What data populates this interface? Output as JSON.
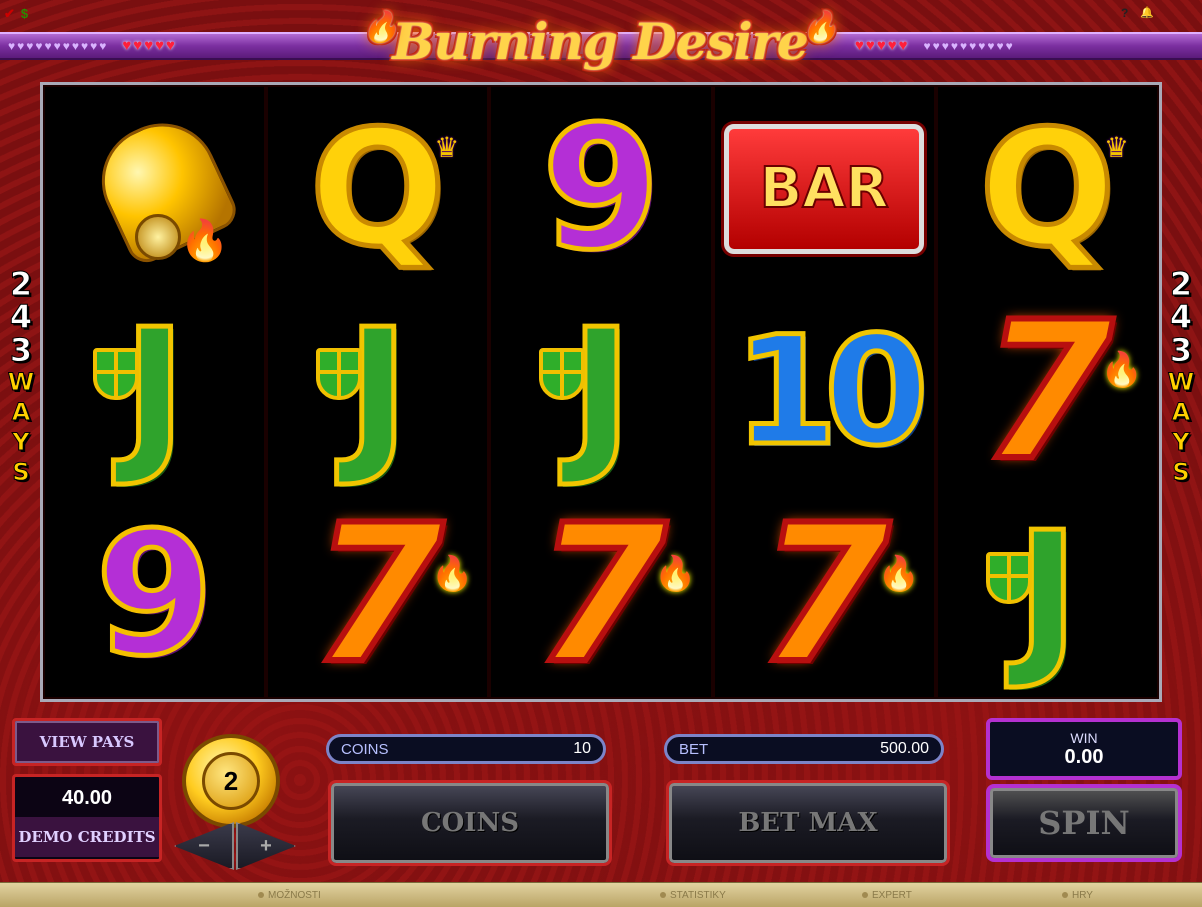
{
  "header": {
    "logo_text": "Burning Desire",
    "left_icons": [
      "checkmark-icon",
      "dollar-icon"
    ],
    "right_icons": [
      "help-icon",
      "sound-icon"
    ],
    "help_glyph": "?",
    "check_glyph": "✔",
    "dollar_glyph": "$",
    "sound_glyph": "🔔"
  },
  "ways": {
    "digits": [
      "2",
      "4",
      "3"
    ],
    "letters": [
      "W",
      "A",
      "Y",
      "S"
    ]
  },
  "reels": [
    [
      "bell",
      "J",
      "9"
    ],
    [
      "Q",
      "J",
      "7"
    ],
    [
      "9",
      "J",
      "7"
    ],
    [
      "BAR",
      "10",
      "7"
    ],
    [
      "Q",
      "7",
      "J"
    ]
  ],
  "controls": {
    "view_pays_label": "VIEW PAYS",
    "credits_value": "40.00",
    "credits_label": "DEMO CREDITS",
    "coin_value": "2",
    "minus_label": "−",
    "plus_label": "+",
    "coins_label": "COINS",
    "coins_value": "10",
    "bet_label": "BET",
    "bet_value": "500.00",
    "coins_button": "COINS",
    "bet_max_button": "BET MAX",
    "win_label": "WIN",
    "win_value": "0.00",
    "spin_button": "SPIN"
  },
  "footer": {
    "items": [
      "MOŽNOSTI",
      "STATISTIKY",
      "EXPERT",
      "HRY"
    ]
  },
  "colors": {
    "accent_purple": "#b430d0",
    "accent_red": "#c72424",
    "background_red": "#861212",
    "footer_gold": "#d4c286"
  }
}
